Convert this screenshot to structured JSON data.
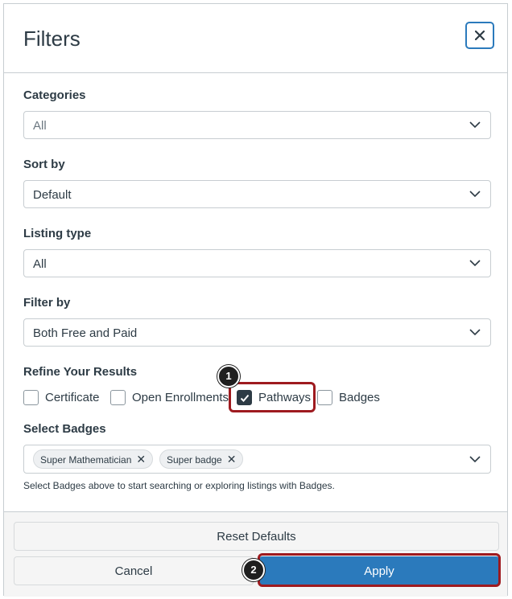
{
  "dialog": {
    "title": "Filters",
    "close_icon": "close-icon"
  },
  "fields": {
    "categories": {
      "label": "Categories",
      "value": "All"
    },
    "sort_by": {
      "label": "Sort by",
      "value": "Default"
    },
    "listing_type": {
      "label": "Listing type",
      "value": "All"
    },
    "filter_by": {
      "label": "Filter by",
      "value": "Both Free and Paid"
    }
  },
  "refine": {
    "label": "Refine Your Results",
    "options": [
      {
        "label": "Certificate",
        "checked": false
      },
      {
        "label": "Open Enrollments",
        "checked": false
      },
      {
        "label": "Pathways",
        "checked": true
      },
      {
        "label": "Badges",
        "checked": false
      }
    ]
  },
  "select_badges": {
    "label": "Select Badges",
    "tags": [
      "Super Mathematician",
      "Super badge"
    ],
    "remove_glyph": "✕",
    "help": "Select Badges above to start searching or exploring listings with Badges."
  },
  "footer": {
    "reset_label": "Reset Defaults",
    "cancel_label": "Cancel",
    "apply_label": "Apply"
  },
  "callouts": [
    "1",
    "2"
  ],
  "colors": {
    "accent": "#2b7abc",
    "callout_border": "#9e1a1f",
    "text": "#2d3b45"
  }
}
